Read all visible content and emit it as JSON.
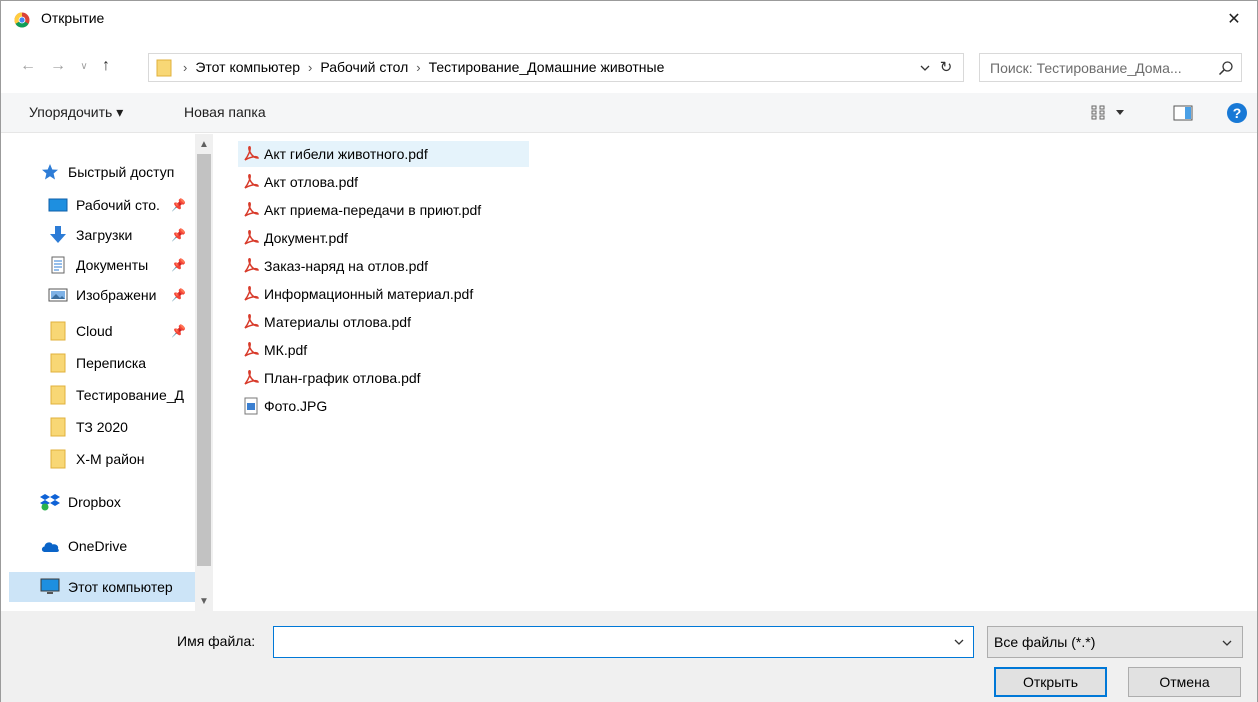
{
  "window": {
    "title": "Открытие",
    "close_glyph": "✕"
  },
  "nav": {
    "back_glyph": "←",
    "forward_glyph": "→",
    "recent_glyph": "∨",
    "up_glyph": "↑",
    "breadcrumbs": [
      "Этот компьютер",
      "Рабочий стол",
      "Тестирование_Домашние животные"
    ],
    "crumb_separator": "›",
    "refresh_glyph": "↻"
  },
  "search": {
    "placeholder": "Поиск: Тестирование_Дома..."
  },
  "toolbar": {
    "organize_label": "Упорядочить ▾",
    "new_folder_label": "Новая папка",
    "help_glyph": "?"
  },
  "sidebar": {
    "scroll_up_glyph": "▲",
    "scroll_down_glyph": "▼",
    "pin_glyph": "📌",
    "items": [
      {
        "label": "Быстрый доступ",
        "icon": "star-icon"
      },
      {
        "label": "Рабочий сто.",
        "icon": "desktop-icon",
        "pinned": true
      },
      {
        "label": "Загрузки",
        "icon": "download-icon",
        "pinned": true
      },
      {
        "label": "Документы",
        "icon": "documents-icon",
        "pinned": true
      },
      {
        "label": "Изображени",
        "icon": "pictures-icon",
        "pinned": true
      },
      {
        "label": "Cloud",
        "icon": "folder-icon",
        "pinned": true
      },
      {
        "label": "Переписка",
        "icon": "folder-icon"
      },
      {
        "label": "Тестирование_Д",
        "icon": "folder-icon"
      },
      {
        "label": "ТЗ 2020",
        "icon": "folder-icon"
      },
      {
        "label": "Х-М район",
        "icon": "folder-icon"
      },
      {
        "label": "Dropbox",
        "icon": "dropbox-icon"
      },
      {
        "label": "OneDrive",
        "icon": "onedrive-icon"
      },
      {
        "label": "Этот компьютер",
        "icon": "computer-icon",
        "selected": true
      }
    ]
  },
  "files": [
    {
      "name": "Акт гибели животного.pdf",
      "type": "pdf",
      "selected": true
    },
    {
      "name": "Акт отлова.pdf",
      "type": "pdf"
    },
    {
      "name": "Акт приема-передачи в приют.pdf",
      "type": "pdf"
    },
    {
      "name": "Документ.pdf",
      "type": "pdf"
    },
    {
      "name": "Заказ-наряд на отлов.pdf",
      "type": "pdf"
    },
    {
      "name": "Информационный материал.pdf",
      "type": "pdf"
    },
    {
      "name": "Материалы отлова.pdf",
      "type": "pdf"
    },
    {
      "name": "МК.pdf",
      "type": "pdf"
    },
    {
      "name": "План-график отлова.pdf",
      "type": "pdf"
    },
    {
      "name": "Фото.JPG",
      "type": "jpg"
    }
  ],
  "bottom": {
    "filename_label": "Имя файла:",
    "filename_value": "",
    "filter_value": "Все файлы (*.*)",
    "open_label": "Открыть",
    "cancel_label": "Отмена"
  },
  "colors": {
    "selection": "#cce4f7",
    "hover": "#e5f3fb",
    "accent": "#0078d7",
    "folder": "#f8d775",
    "pdf": "#d83b2b"
  }
}
